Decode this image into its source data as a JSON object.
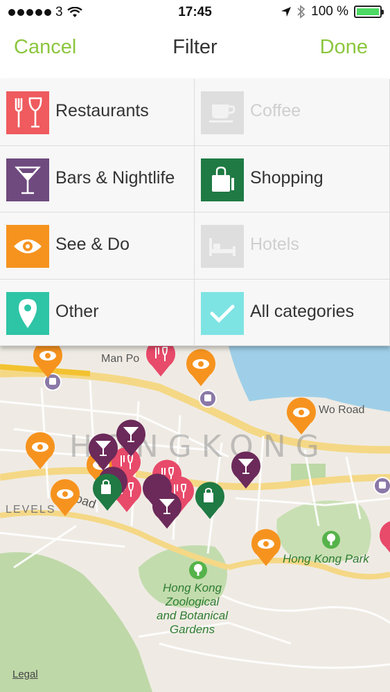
{
  "status_bar": {
    "carrier": "3",
    "time": "17:45",
    "battery": "100 %"
  },
  "nav": {
    "cancel": "Cancel",
    "title": "Filter",
    "done": "Done"
  },
  "categories": [
    {
      "label": "Restaurants",
      "color": "#ef5b5e",
      "icon": "cutlery-icon",
      "enabled": true
    },
    {
      "label": "Coffee",
      "color": "#dedede",
      "icon": "coffee-cup-icon",
      "enabled": false
    },
    {
      "label": "Bars & Nightlife",
      "color": "#6e4a7e",
      "icon": "cocktail-icon",
      "enabled": true
    },
    {
      "label": "Shopping",
      "color": "#1f7a43",
      "icon": "shopping-bag-icon",
      "enabled": true
    },
    {
      "label": "See & Do",
      "color": "#f6931f",
      "icon": "eye-icon",
      "enabled": true
    },
    {
      "label": "Hotels",
      "color": "#dedede",
      "icon": "bed-icon",
      "enabled": false
    },
    {
      "label": "Other",
      "color": "#2ec4a6",
      "icon": "location-pin-icon",
      "enabled": true
    },
    {
      "label": "All categories",
      "color": "#7ee3e3",
      "icon": "checkmark-icon",
      "enabled": true
    }
  ],
  "map": {
    "city_label": "HONGKONG",
    "labels": {
      "man_po": "Man Po",
      "wo_road": "Wo Road",
      "levels": "LEVELS",
      "road": "Road",
      "hong_kong_park": "Hong Kong Park",
      "zoo": "Hong Kong\nZoological\nand Botanical\nGardens"
    },
    "legal": "Legal"
  }
}
